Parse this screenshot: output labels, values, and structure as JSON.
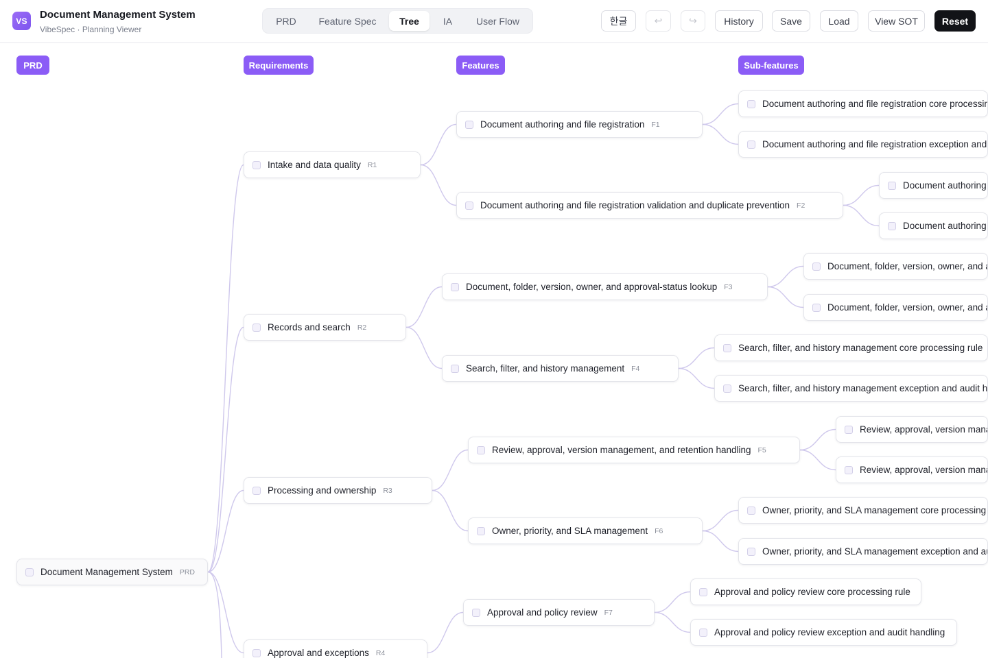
{
  "app": {
    "logo_text": "VS",
    "title": "Document Management System",
    "subtitle": "VibeSpec · Planning Viewer"
  },
  "tabs": [
    {
      "label": "PRD",
      "active": false
    },
    {
      "label": "Feature Spec",
      "active": false
    },
    {
      "label": "Tree",
      "active": true
    },
    {
      "label": "IA",
      "active": false
    },
    {
      "label": "User Flow",
      "active": false
    }
  ],
  "actions": {
    "language": "한글",
    "undo": "↩",
    "redo": "↪",
    "history": "History",
    "save": "Save",
    "load": "Load",
    "view_sot": "View SOT",
    "reset": "Reset"
  },
  "columns": {
    "prd": "PRD",
    "requirements": "Requirements",
    "features": "Features",
    "subfeatures": "Sub-features"
  },
  "tree": {
    "root": {
      "label": "Document Management System",
      "code": "PRD"
    },
    "requirements": [
      {
        "label": "Intake and data quality",
        "code": "R1"
      },
      {
        "label": "Records and search",
        "code": "R2"
      },
      {
        "label": "Processing and ownership",
        "code": "R3"
      },
      {
        "label": "Approval and exceptions",
        "code": "R4"
      }
    ],
    "features": [
      {
        "label": "Document authoring and file registration",
        "code": "F1"
      },
      {
        "label": "Document authoring and file registration validation and duplicate prevention",
        "code": "F2"
      },
      {
        "label": "Document, folder, version, owner, and approval-status lookup",
        "code": "F3"
      },
      {
        "label": "Search, filter, and history management",
        "code": "F4"
      },
      {
        "label": "Review, approval, version management, and retention handling",
        "code": "F5"
      },
      {
        "label": "Owner, priority, and SLA management",
        "code": "F6"
      },
      {
        "label": "Approval and policy review",
        "code": "F7"
      }
    ],
    "subfeatures": [
      {
        "label": "Document authoring and file registration core processing rule"
      },
      {
        "label": "Document authoring and file registration exception and audit handling"
      },
      {
        "label": "Document authoring and file registration validation and duplicate prevention core processing rule"
      },
      {
        "label": "Document authoring and file registration validation and duplicate prevention exception and audit handling"
      },
      {
        "label": "Document, folder, version, owner, and approval-status lookup core processing rule"
      },
      {
        "label": "Document, folder, version, owner, and approval-status lookup exception and audit handling"
      },
      {
        "label": "Search, filter, and history management core processing rule"
      },
      {
        "label": "Search, filter, and history management exception and audit handling"
      },
      {
        "label": "Review, approval, version management, and retention handling core processing rule"
      },
      {
        "label": "Review, approval, version management, and retention handling exception and audit handling"
      },
      {
        "label": "Owner, priority, and SLA management core processing rule"
      },
      {
        "label": "Owner, priority, and SLA management exception and audit handling"
      },
      {
        "label": "Approval and policy review core processing rule"
      },
      {
        "label": "Approval and policy review exception and audit handling"
      }
    ]
  },
  "colors": {
    "accent": "#8b5cf6",
    "edge": "#cfc8ec",
    "primary_button": "#121317"
  }
}
